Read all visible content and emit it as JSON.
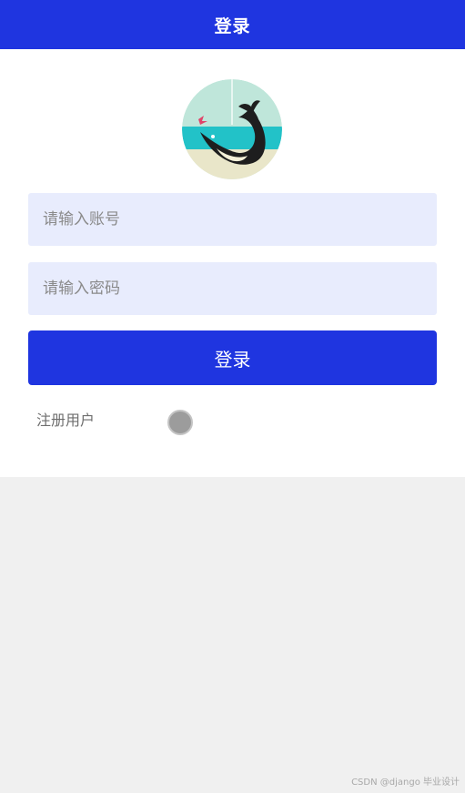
{
  "navbar": {
    "title": "登录"
  },
  "avatar": {
    "icon": "whale-logo"
  },
  "form": {
    "account_placeholder": "请输入账号",
    "password_placeholder": "请输入密码",
    "login_label": "登录",
    "register_label": "注册用户"
  },
  "watermark": "CSDN @django 毕业设计",
  "colors": {
    "primary": "#1f35e0",
    "input_bg": "#e8ecfd",
    "page_bg": "#f0f0f0"
  }
}
